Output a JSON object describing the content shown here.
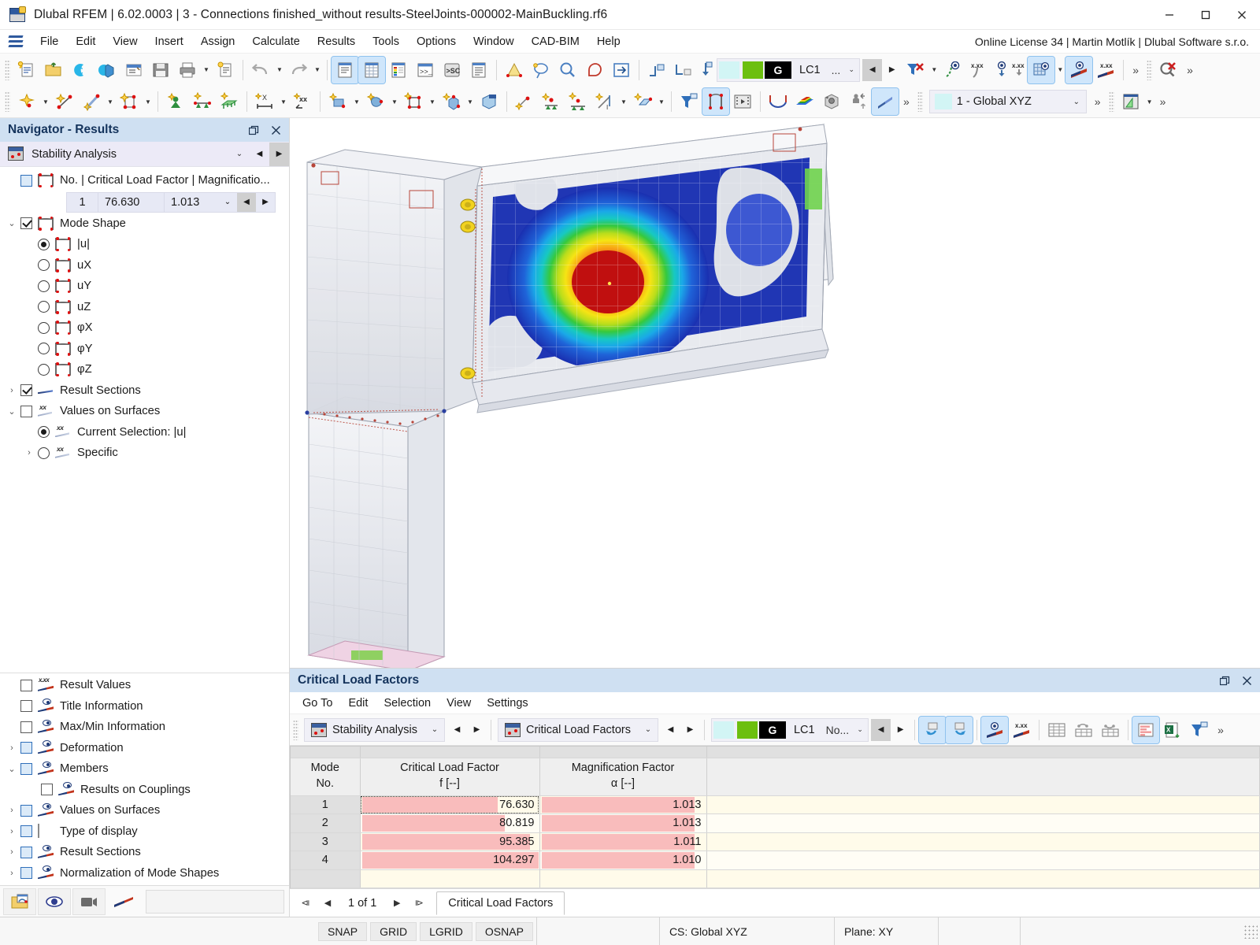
{
  "window": {
    "title": "Dlubal RFEM | 6.02.0003 | 3 - Connections finished_without results-SteelJoints-000002-MainBuckling.rf6",
    "minimize": "─",
    "maximize": "☐",
    "close": "✕",
    "app_icon": "rfem-app-icon"
  },
  "menubar": {
    "items": [
      {
        "label": "File"
      },
      {
        "label": "Edit"
      },
      {
        "label": "View"
      },
      {
        "label": "Insert"
      },
      {
        "label": "Assign"
      },
      {
        "label": "Calculate"
      },
      {
        "label": "Results"
      },
      {
        "label": "Tools"
      },
      {
        "label": "Options"
      },
      {
        "label": "Window"
      },
      {
        "label": "CAD-BIM"
      },
      {
        "label": "Help"
      }
    ],
    "license": "Online License 34 | Martin Motlík | Dlubal Software s.r.o."
  },
  "toolbar": {
    "load_case": {
      "letter": "G",
      "case": "LC1",
      "more": "...",
      "dropdown": "⌄"
    },
    "coord_system": {
      "value": "1 - Global XYZ",
      "dropdown": "⌄"
    },
    "overflow": "»"
  },
  "navigator": {
    "title": "Navigator - Results",
    "restore_icon": "restore-icon",
    "close_icon": "close-icon",
    "module": {
      "label": "Stability Analysis",
      "dropdown": "⌄"
    },
    "mode_row": {
      "label": "No. | Critical Load Factor | Magnificatio...",
      "no": "1",
      "critical_load_factor": "76.630",
      "magnification_factor": "1.013",
      "dropdown": "⌄"
    },
    "tree": [
      {
        "label": "Mode Shape",
        "type": "checkbox",
        "state": "checked",
        "expander": "⌄",
        "icon": "member-icon",
        "indent": 0
      },
      {
        "label": "|u|",
        "type": "radio",
        "state": "selected",
        "icon": "member-icon",
        "indent": 1
      },
      {
        "label": "uX",
        "type": "radio",
        "state": "off",
        "icon": "member-icon",
        "indent": 1
      },
      {
        "label": "uY",
        "type": "radio",
        "state": "off",
        "icon": "member-icon",
        "indent": 1
      },
      {
        "label": "uZ",
        "type": "radio",
        "state": "off",
        "icon": "member-icon",
        "indent": 1
      },
      {
        "label": "φX",
        "type": "radio",
        "state": "off",
        "icon": "member-icon",
        "indent": 1
      },
      {
        "label": "φY",
        "type": "radio",
        "state": "off",
        "icon": "member-icon",
        "indent": 1
      },
      {
        "label": "φZ",
        "type": "radio",
        "state": "off",
        "icon": "member-icon",
        "indent": 1
      },
      {
        "label": "Result Sections",
        "type": "checkbox",
        "state": "checked",
        "expander": "›",
        "icon": "ribbon-icon",
        "indent": 0
      },
      {
        "label": "Values on Surfaces",
        "type": "checkbox",
        "state": "empty",
        "expander": "⌄",
        "icon": "xx-icon",
        "indent": 0
      },
      {
        "label": "Current Selection: |u|",
        "type": "radio",
        "state": "selected",
        "icon": "xx-icon",
        "indent": 1
      },
      {
        "label": "Specific",
        "type": "radio",
        "state": "off",
        "expander": "›",
        "icon": "xx-icon",
        "indent": 1
      }
    ],
    "tree_bottom": [
      {
        "label": "Result Values",
        "type": "checkbox",
        "state": "empty",
        "icon": "xxx-ribbon-icon",
        "indent": 0
      },
      {
        "label": "Title Information",
        "type": "checkbox",
        "state": "empty",
        "icon": "eye-ribbon-icon",
        "indent": 0
      },
      {
        "label": "Max/Min Information",
        "type": "checkbox",
        "state": "empty",
        "icon": "eye-ribbon-icon",
        "indent": 0
      },
      {
        "label": "Deformation",
        "type": "checkbox",
        "state": "part",
        "expander": "›",
        "icon": "eye-ribbon-icon",
        "indent": 0
      },
      {
        "label": "Members",
        "type": "checkbox",
        "state": "part",
        "expander": "⌄",
        "icon": "eye-ribbon-icon",
        "indent": 0
      },
      {
        "label": "Results on Couplings",
        "type": "checkbox",
        "state": "empty",
        "icon": "eye-ribbon-icon",
        "indent": 1
      },
      {
        "label": "Values on Surfaces",
        "type": "checkbox",
        "state": "part",
        "expander": "›",
        "icon": "eye-ribbon-icon",
        "indent": 0
      },
      {
        "label": "Type of display",
        "type": "checkbox",
        "state": "part",
        "expander": "›",
        "icon": "rainbow-icon",
        "indent": 0
      },
      {
        "label": "Result Sections",
        "type": "checkbox",
        "state": "part",
        "expander": "›",
        "icon": "eye-ribbon-icon",
        "indent": 0
      },
      {
        "label": "Normalization of Mode Shapes",
        "type": "checkbox",
        "state": "part",
        "expander": "›",
        "icon": "eye-ribbon-icon",
        "indent": 0
      }
    ]
  },
  "table_panel": {
    "title": "Critical Load Factors",
    "restore_icon": "restore-icon",
    "close_icon": "close-icon",
    "menu": [
      {
        "label": "Go To"
      },
      {
        "label": "Edit"
      },
      {
        "label": "Selection"
      },
      {
        "label": "View"
      },
      {
        "label": "Settings"
      }
    ],
    "combo_left": {
      "label": "Stability Analysis",
      "dropdown": "⌄"
    },
    "combo_right": {
      "label": "Critical Load Factors",
      "dropdown": "⌄"
    },
    "load_case": {
      "letter": "G",
      "case": "LC1",
      "more": "No...",
      "dropdown": "⌄"
    },
    "columns": [
      {
        "title": "Mode",
        "unit": "No."
      },
      {
        "title": "Critical Load Factor",
        "unit": "f [--]"
      },
      {
        "title": "Magnification Factor",
        "unit": "α [--]"
      },
      {
        "title": "",
        "unit": ""
      }
    ],
    "rows": [
      {
        "no": "1",
        "critical_load_factor": "76.630",
        "magnification_factor": "1.013",
        "clf_bar_pct": 76,
        "mag_bar_pct": 92,
        "selected": true
      },
      {
        "no": "2",
        "critical_load_factor": "80.819",
        "magnification_factor": "1.013",
        "clf_bar_pct": 80,
        "mag_bar_pct": 92,
        "selected": false
      },
      {
        "no": "3",
        "critical_load_factor": "95.385",
        "magnification_factor": "1.011",
        "clf_bar_pct": 94,
        "mag_bar_pct": 92,
        "selected": false
      },
      {
        "no": "4",
        "critical_load_factor": "104.297",
        "magnification_factor": "1.010",
        "clf_bar_pct": 100,
        "mag_bar_pct": 92,
        "selected": false
      }
    ],
    "pager": {
      "first": "⧏",
      "prev": "◀",
      "next": "▶",
      "last": "⧐",
      "count": "1 of 1",
      "tab": "Critical Load Factors"
    }
  },
  "statusbar": {
    "buttons": [
      {
        "label": "SNAP"
      },
      {
        "label": "GRID"
      },
      {
        "label": "LGRID"
      },
      {
        "label": "OSNAP"
      }
    ],
    "coord_system": "CS: Global XYZ",
    "plane": "Plane: XY"
  },
  "colors": {
    "panel_header": "#cfe0f2",
    "accent": "#2f6fba",
    "bar_fill": "#f9bcbc",
    "row_odd": "#fffbea",
    "selection_green": "#6cbf0f"
  }
}
